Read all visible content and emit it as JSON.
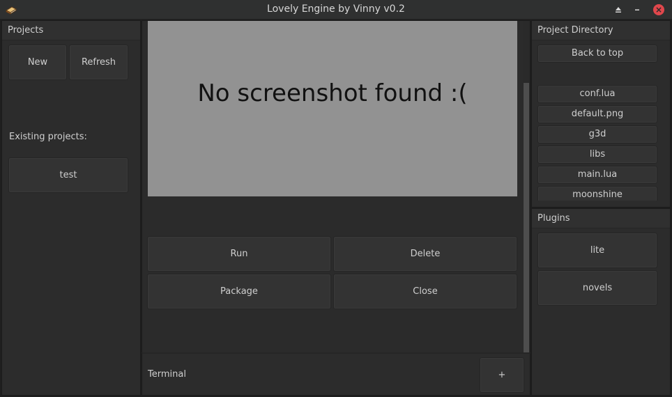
{
  "window": {
    "title": "Lovely Engine by Vinny v0.2"
  },
  "projects": {
    "header": "Projects",
    "new_label": "New",
    "refresh_label": "Refresh",
    "existing_label": "Existing projects:",
    "items": [
      "test"
    ]
  },
  "center": {
    "preview_text": "No screenshot found :(",
    "run_label": "Run",
    "delete_label": "Delete",
    "package_label": "Package",
    "close_label": "Close"
  },
  "terminal": {
    "label": "Terminal",
    "add_label": "+"
  },
  "directory": {
    "header": "Project Directory",
    "back_label": "Back to top",
    "files": [
      "conf.lua",
      "default.png",
      "g3d",
      "libs",
      "main.lua",
      "moonshine"
    ]
  },
  "plugins": {
    "header": "Plugins",
    "items": [
      "lite",
      "novels"
    ]
  },
  "colors": {
    "close_button": "#e0474c",
    "preview_bg": "#929292"
  }
}
